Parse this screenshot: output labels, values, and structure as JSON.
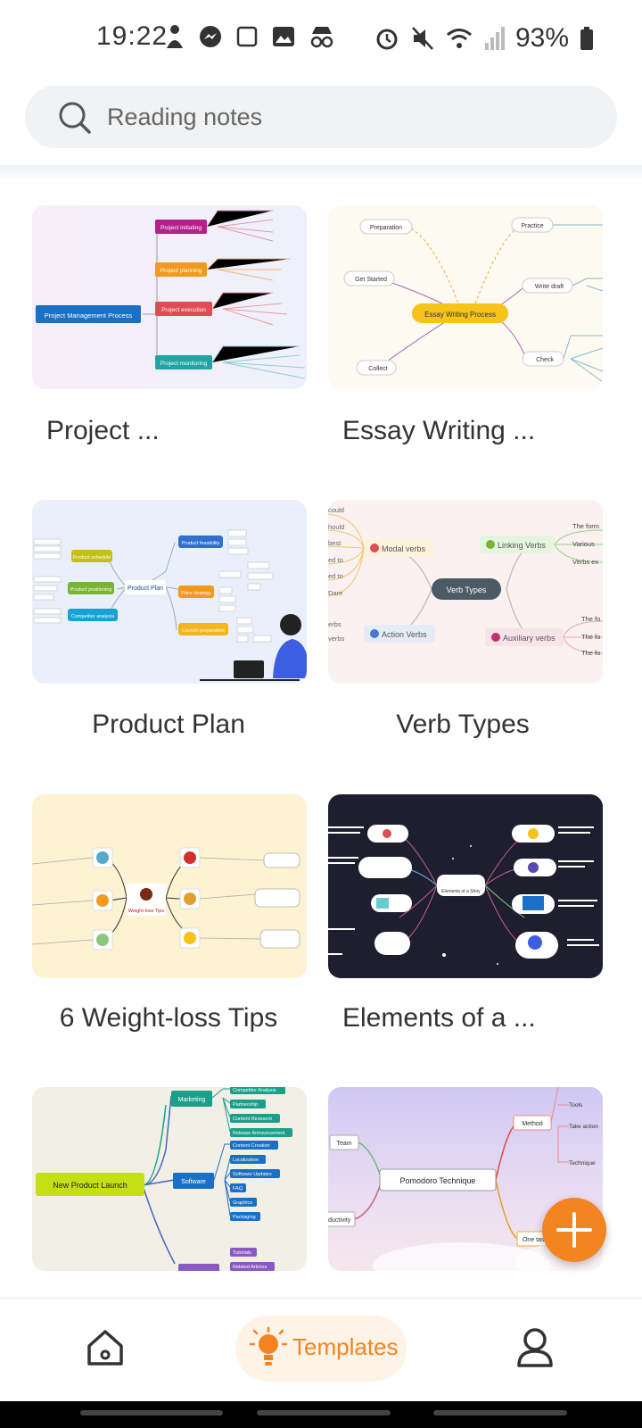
{
  "status": {
    "time": "19:22",
    "battery": "93%"
  },
  "search": {
    "placeholder": "Reading notes"
  },
  "templates": [
    {
      "title": "Project ...",
      "preview": {
        "center": "Project Management Process",
        "branches": [
          "Project initiating",
          "Project planning",
          "Project execution",
          "Project monitoring"
        ]
      }
    },
    {
      "title": "Essay Writing ...",
      "preview": {
        "center": "Essay Writing Process",
        "branches": [
          "Preparation",
          "Get Started",
          "Collect",
          "Practice",
          "Write draft",
          "Check"
        ]
      }
    },
    {
      "title": "Product Plan",
      "preview": {
        "center": "Product Plan",
        "branches": [
          "Product feasibility",
          "Price strategy",
          "Launch preparation",
          "Product schedule",
          "Product positioning",
          "Competitor analysis"
        ]
      }
    },
    {
      "title": "Verb Types",
      "preview": {
        "center": "Verb Types",
        "branches": [
          "Modal verbs",
          "Linking Verbs",
          "Action Verbs",
          "Auxiliary verbs"
        ],
        "side_left": [
          "could",
          "hould",
          "best",
          "ed to",
          "ed to",
          "Dare",
          "erbs",
          "verbs"
        ],
        "side_right": [
          "The form",
          "Various",
          "Verbs ex",
          "The fo",
          "The fo",
          "The fo"
        ]
      }
    },
    {
      "title": "6 Weight-loss Tips",
      "preview": {
        "center": "Weight-loss Tips"
      }
    },
    {
      "title": "Elements of a ...",
      "preview": {
        "center": "Elements of a Story"
      }
    },
    {
      "title": "",
      "preview": {
        "center": "New Product Launch",
        "branches": [
          "Marketing",
          "Software"
        ],
        "leaves": [
          "Competitor Analysis",
          "Partnership",
          "Content Research",
          "Release Announcement",
          "Content Creation",
          "Localization",
          "Software Updates",
          "FAQ",
          "Graphics",
          "Packaging",
          "Tutorials",
          "Related Articles"
        ]
      }
    },
    {
      "title": "",
      "preview": {
        "center": "Pomodoro Technique",
        "branches": [
          "Team",
          "ductivity",
          "Method",
          "One task"
        ],
        "leaves": [
          "Tools",
          "Take action",
          "Technique"
        ]
      }
    }
  ],
  "nav": {
    "templates_label": "Templates"
  },
  "colors": {
    "accent": "#f4841f",
    "nav_active_bg": "#fff3e7"
  },
  "icons": [
    "alarm-icon",
    "mute-icon",
    "wifi-icon",
    "signal-icon",
    "battery-icon",
    "search-icon",
    "add-icon",
    "home-icon",
    "lightbulb-icon",
    "profile-icon"
  ]
}
